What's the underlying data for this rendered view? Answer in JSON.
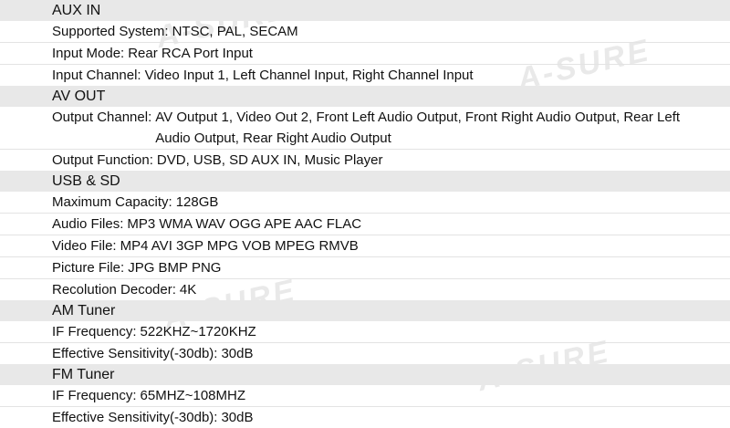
{
  "watermark_text": "A-SURE",
  "sections": [
    {
      "title": "AUX IN",
      "rows": [
        {
          "label": "Supported System:",
          "value": "NTSC, PAL, SECAM"
        },
        {
          "label": "Input Mode:",
          "value": "Rear RCA Port Input"
        },
        {
          "label": "Input Channel:",
          "value": "Video Input 1, Left Channel Input, Right Channel Input"
        }
      ]
    },
    {
      "title": "AV OUT",
      "rows": [
        {
          "label": "Output Channel:",
          "value": "AV Output 1, Video Out 2, Front Left Audio Output, Front Right Audio Output, Rear Left Audio Output, Rear Right Audio Output"
        },
        {
          "label": "Output Function:",
          "value": "DVD, USB, SD AUX IN, Music Player"
        }
      ]
    },
    {
      "title": "USB & SD",
      "rows": [
        {
          "label": "Maximum Capacity:",
          "value": "128GB"
        },
        {
          "label": "Audio Files:",
          "value": "MP3 WMA WAV OGG APE AAC FLAC"
        },
        {
          "label": "Video File:",
          "value": "MP4 AVI 3GP MPG VOB MPEG RMVB"
        },
        {
          "label": "Picture File:",
          "value": "JPG BMP PNG"
        },
        {
          "label": "Recolution Decoder:",
          "value": "4K"
        }
      ]
    },
    {
      "title": "AM Tuner",
      "rows": [
        {
          "label": "IF Frequency:",
          "value": "522KHZ~1720KHZ"
        },
        {
          "label": "Effective Sensitivity(-30db):",
          "value": "30dB"
        }
      ]
    },
    {
      "title": "FM Tuner",
      "rows": [
        {
          "label": "IF Frequency:",
          "value": "65MHZ~108MHZ"
        },
        {
          "label": "Effective Sensitivity(-30db):",
          "value": "30dB"
        }
      ]
    }
  ]
}
